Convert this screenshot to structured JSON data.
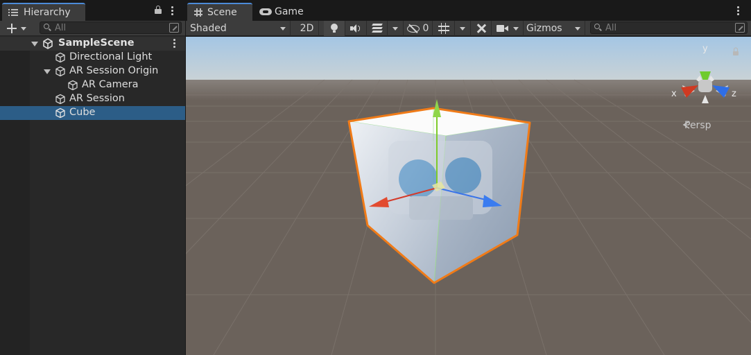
{
  "hierarchy": {
    "tab_label": "Hierarchy",
    "search_placeholder": "All",
    "scene_name": "SampleScene",
    "items": [
      {
        "label": "Directional Light"
      },
      {
        "label": "AR Session Origin"
      },
      {
        "label": "AR Camera"
      },
      {
        "label": "AR Session"
      },
      {
        "label": "Cube"
      }
    ]
  },
  "scene_view": {
    "tabs": [
      {
        "label": "Scene",
        "icon": "grid-hash-icon"
      },
      {
        "label": "Game",
        "icon": "gamepad-icon"
      }
    ],
    "toolbar": {
      "draw_mode": "Shaded",
      "mode_2d": "2D",
      "hidden_count": "0",
      "gizmos_label": "Gizmos",
      "search_placeholder": "All"
    },
    "orientation_gizmo": {
      "x_label": "x",
      "y_label": "y",
      "z_label": "z",
      "projection_label": "Persp"
    }
  },
  "colors": {
    "selection": "#2c5d87",
    "tab_accent": "#4c8bd8",
    "selection_outline": "#f07b18",
    "axis_x": "#d43a2a",
    "axis_y": "#7ecb2a",
    "axis_z": "#3a74e8",
    "ground": "#6b625b",
    "sky": "#a8c8e4"
  }
}
